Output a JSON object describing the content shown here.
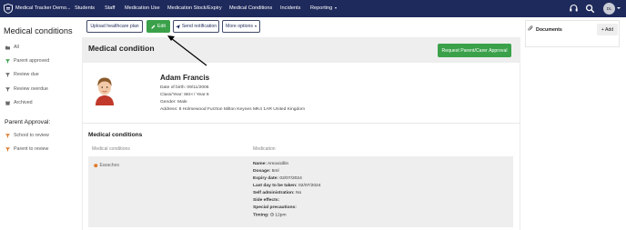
{
  "nav": {
    "app_title": "Medical Tracker Demo...",
    "items": [
      "Students",
      "Staff",
      "Medication Use",
      "Medication Stock/Expiry",
      "Medical Conditions",
      "Incidents",
      "Reporting"
    ],
    "avatar_initials": "DL"
  },
  "sidebar": {
    "title": "Medical conditions",
    "items": [
      "All",
      "Parent approved",
      "Review due",
      "Review overdue",
      "Archived"
    ],
    "approval_title": "Parent Approval:",
    "approval_items": [
      "School to review",
      "Parent to review"
    ]
  },
  "toolbar": {
    "upload_label": "Upload healthcare plan",
    "edit_label": "Edit",
    "notify_label": "Send notification",
    "more_label": "More options"
  },
  "panel": {
    "title": "Medical condition",
    "request_label": "Request Parent/Carer Approval"
  },
  "person": {
    "name": "Adam Francis",
    "dob_label": "Date of birth:",
    "dob": "09/11/2006",
    "class_label": "Class/Year:",
    "class": "6KH / Year 6",
    "gender_label": "Gender:",
    "gender": "Male",
    "address_label": "Address:",
    "address": "8 Holmewood Furzton Milton Keynes MK4 1AR United Kingdom"
  },
  "conditions": {
    "title": "Medical conditions",
    "col_conditions": "Medical conditions",
    "col_medication": "Medication",
    "condition_name": "Earaches",
    "med": {
      "name_label": "Name:",
      "name": "Amoxicillin",
      "dosage_label": "Dosage:",
      "dosage": "5ml",
      "expiry_label": "Expiry date:",
      "expiry": "02/07/2024",
      "lastday_label": "Last day to be taken:",
      "lastday": "02/07/2024",
      "selfadmin_label": "Self administration:",
      "selfadmin": "No",
      "side_label": "Side effects:",
      "special_label": "Special precautions:",
      "timing_label": "Timing:",
      "timing": "12pm"
    }
  },
  "documents": {
    "title": "Documents",
    "add_label": "+ Add"
  },
  "colors": {
    "nav_bg": "#1f2a5c",
    "green": "#3aa14a",
    "approved_icon": "#3aa14a",
    "review_icon": "#e07a2a"
  }
}
